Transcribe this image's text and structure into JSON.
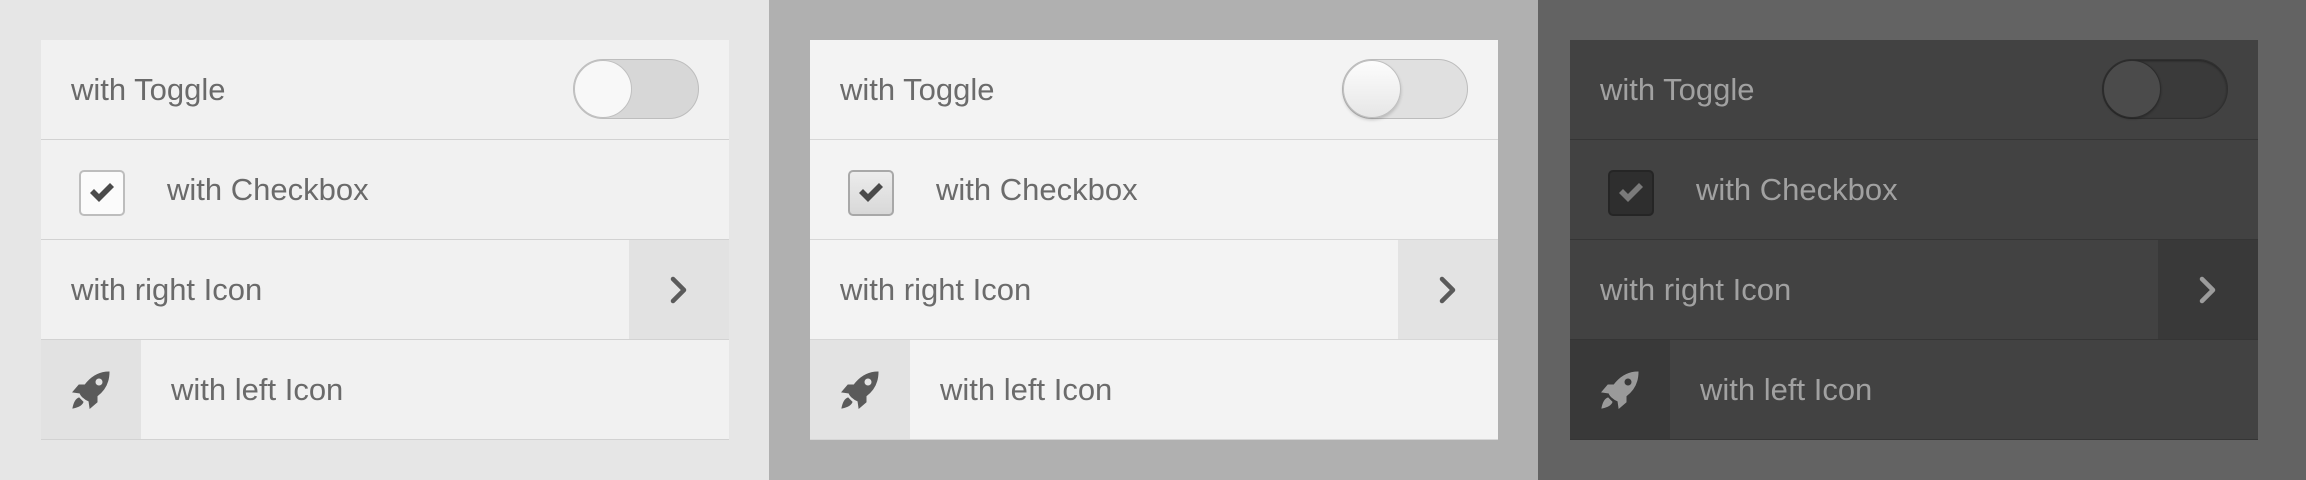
{
  "panels": [
    {
      "theme": "light",
      "background": "#e6e6e6",
      "toggle_label": "with Toggle",
      "toggle_on": false,
      "checkbox_label": "with Checkbox",
      "checkbox_checked": true,
      "right_icon_label": "with right Icon",
      "right_icon": "chevron-right-icon",
      "left_icon_label": "with left Icon",
      "left_icon": "rocket-icon"
    },
    {
      "theme": "mid",
      "background": "#b0b0b0",
      "toggle_label": "with Toggle",
      "toggle_on": false,
      "checkbox_label": "with Checkbox",
      "checkbox_checked": true,
      "right_icon_label": "with right Icon",
      "right_icon": "chevron-right-icon",
      "left_icon_label": "with left Icon",
      "left_icon": "rocket-icon"
    },
    {
      "theme": "dark",
      "background": "#636363",
      "toggle_label": "with Toggle",
      "toggle_on": false,
      "checkbox_label": "with Checkbox",
      "checkbox_checked": true,
      "right_icon_label": "with right Icon",
      "right_icon": "chevron-right-icon",
      "left_icon_label": "with left Icon",
      "left_icon": "rocket-icon"
    }
  ]
}
